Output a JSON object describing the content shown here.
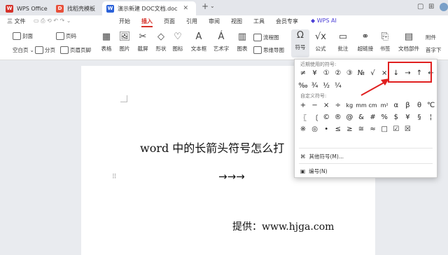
{
  "tabs": [
    {
      "label": "WPS Office",
      "icon": "W",
      "color": "#d6322a"
    },
    {
      "label": "找稻壳模板",
      "icon": "D",
      "color": "#e8503a"
    },
    {
      "label": "演示新建 DOC文档.doc",
      "icon": "W",
      "color": "#2b62d9"
    }
  ],
  "menu": {
    "file": "三 文件",
    "items": [
      "开始",
      "插入",
      "页面",
      "引用",
      "审阅",
      "视图",
      "工具",
      "会员专享",
      "WPS AI"
    ]
  },
  "ribbon": {
    "blank": "空白页",
    "section": "分页",
    "cover": "封面",
    "pagenum": "页码",
    "header_footer": "页眉页脚",
    "table": "表格",
    "picture": "图片",
    "screenshot": "截屏",
    "shape": "形状",
    "icon": "图标",
    "textbox": "文本框",
    "wordart": "艺术字",
    "chart": "图表",
    "flowchart": "流程图",
    "mindmap": "思维导图",
    "symbol": "符号",
    "formula": "公式",
    "comment": "批注",
    "hyperlink": "超链接",
    "bookmark": "书签",
    "docparts": "文档部件",
    "attach": "附件",
    "nav": "首字下"
  },
  "doc": {
    "title": "word 中的长箭头符号怎么打",
    "arrows": "→→→",
    "source": "提供：www.hjga.com"
  },
  "dropdown": {
    "recent_label": "近期使用的符号:",
    "recent": [
      "≠",
      "¥",
      "①",
      "②",
      "③",
      "№",
      "√",
      "×",
      "↓",
      "→",
      "↑",
      "←",
      "‰",
      "¾",
      "½",
      "¼"
    ],
    "custom_label": "自定义符号:",
    "custom": [
      "+",
      "−",
      "×",
      "÷",
      "kg",
      "mm",
      "cm",
      "m²",
      "α",
      "β",
      "θ",
      "℃",
      "〖",
      "〔",
      "©",
      "®",
      "@",
      "&",
      "#",
      "%",
      "$",
      "¥",
      "§",
      "¦",
      "※",
      "◎",
      "•",
      "≤",
      "≥",
      "≅",
      "≈",
      "□",
      "☑",
      "☒"
    ],
    "more": "其他符号(M)...",
    "number": "编号(N)"
  }
}
